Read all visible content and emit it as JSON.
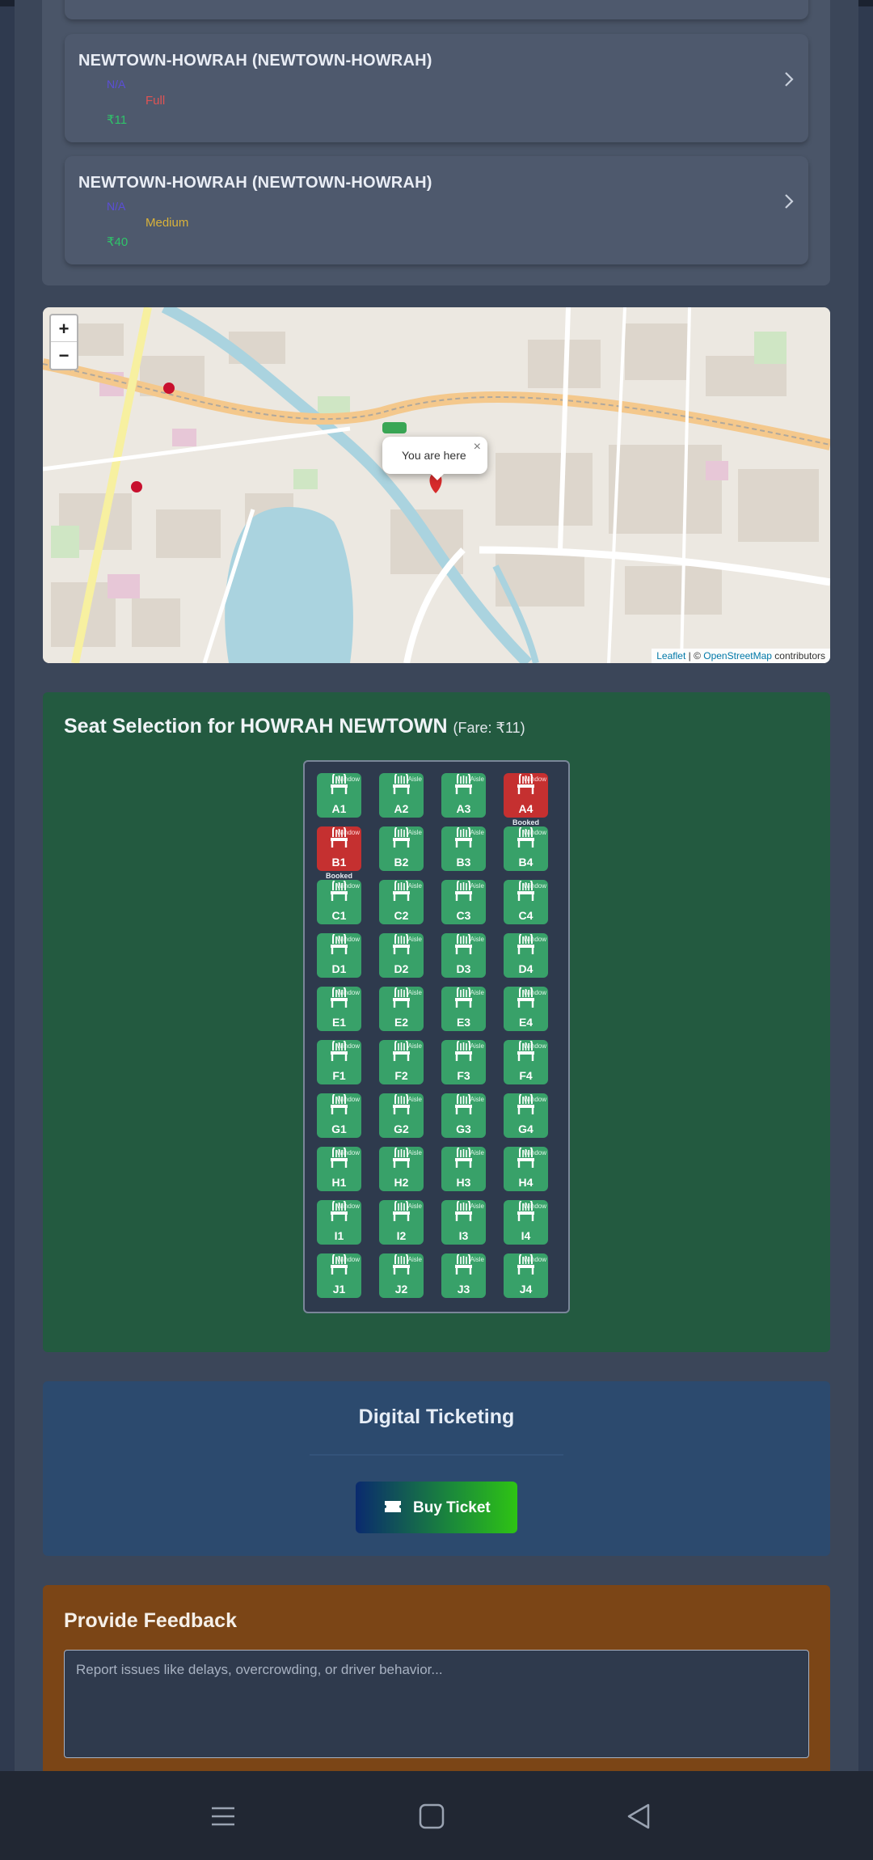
{
  "routes": [
    {
      "title": "NEWTOWN-HOWRAH (NEWTOWN-HOWRAH)",
      "na": "N/A",
      "crowd": "Full",
      "crowd_color": "#e05353",
      "fare": "₹11"
    },
    {
      "title": "NEWTOWN-HOWRAH (NEWTOWN-HOWRAH)",
      "na": "N/A",
      "crowd": "Medium",
      "crowd_color": "#d9b23a",
      "fare": "₹40"
    }
  ],
  "map": {
    "zoom_in": "+",
    "zoom_out": "−",
    "popup_text": "You are here",
    "popup_close": "×",
    "attribution_leaflet": "Leaflet",
    "attribution_sep": " | © ",
    "attribution_osm": "OpenStreetMap",
    "attribution_tail": " contributors"
  },
  "seat_selection": {
    "title": "Seat Selection for HOWRAH NEWTOWN",
    "fare": "(Fare: ₹11)",
    "booked_note": "Booked",
    "rows": [
      {
        "seats": [
          {
            "id": "A1",
            "tag": "Window",
            "booked": false
          },
          {
            "id": "A2",
            "tag": "Aisle",
            "booked": false
          },
          {
            "id": "A3",
            "tag": "Aisle",
            "booked": false
          },
          {
            "id": "A4",
            "tag": "Window",
            "booked": true
          }
        ]
      },
      {
        "seats": [
          {
            "id": "B1",
            "tag": "Window",
            "booked": true
          },
          {
            "id": "B2",
            "tag": "Aisle",
            "booked": false
          },
          {
            "id": "B3",
            "tag": "Aisle",
            "booked": false
          },
          {
            "id": "B4",
            "tag": "Window",
            "booked": false
          }
        ]
      },
      {
        "seats": [
          {
            "id": "C1",
            "tag": "Window",
            "booked": false
          },
          {
            "id": "C2",
            "tag": "Aisle",
            "booked": false
          },
          {
            "id": "C3",
            "tag": "Aisle",
            "booked": false
          },
          {
            "id": "C4",
            "tag": "Window",
            "booked": false
          }
        ]
      },
      {
        "seats": [
          {
            "id": "D1",
            "tag": "Window",
            "booked": false
          },
          {
            "id": "D2",
            "tag": "Aisle",
            "booked": false
          },
          {
            "id": "D3",
            "tag": "Aisle",
            "booked": false
          },
          {
            "id": "D4",
            "tag": "Window",
            "booked": false
          }
        ]
      },
      {
        "seats": [
          {
            "id": "E1",
            "tag": "Window",
            "booked": false
          },
          {
            "id": "E2",
            "tag": "Aisle",
            "booked": false
          },
          {
            "id": "E3",
            "tag": "Aisle",
            "booked": false
          },
          {
            "id": "E4",
            "tag": "Window",
            "booked": false
          }
        ]
      },
      {
        "seats": [
          {
            "id": "F1",
            "tag": "Window",
            "booked": false
          },
          {
            "id": "F2",
            "tag": "Aisle",
            "booked": false
          },
          {
            "id": "F3",
            "tag": "Aisle",
            "booked": false
          },
          {
            "id": "F4",
            "tag": "Window",
            "booked": false
          }
        ]
      },
      {
        "seats": [
          {
            "id": "G1",
            "tag": "Window",
            "booked": false
          },
          {
            "id": "G2",
            "tag": "Aisle",
            "booked": false
          },
          {
            "id": "G3",
            "tag": "Aisle",
            "booked": false
          },
          {
            "id": "G4",
            "tag": "Window",
            "booked": false
          }
        ]
      },
      {
        "seats": [
          {
            "id": "H1",
            "tag": "Window",
            "booked": false
          },
          {
            "id": "H2",
            "tag": "Aisle",
            "booked": false
          },
          {
            "id": "H3",
            "tag": "Aisle",
            "booked": false
          },
          {
            "id": "H4",
            "tag": "Window",
            "booked": false
          }
        ]
      },
      {
        "seats": [
          {
            "id": "I1",
            "tag": "Window",
            "booked": false
          },
          {
            "id": "I2",
            "tag": "Aisle",
            "booked": false
          },
          {
            "id": "I3",
            "tag": "Aisle",
            "booked": false
          },
          {
            "id": "I4",
            "tag": "Window",
            "booked": false
          }
        ]
      },
      {
        "seats": [
          {
            "id": "J1",
            "tag": "Window",
            "booked": false
          },
          {
            "id": "J2",
            "tag": "Aisle",
            "booked": false
          },
          {
            "id": "J3",
            "tag": "Aisle",
            "booked": false
          },
          {
            "id": "J4",
            "tag": "Window",
            "booked": false
          }
        ]
      }
    ]
  },
  "ticketing": {
    "title": "Digital Ticketing",
    "button": "Buy Ticket"
  },
  "feedback": {
    "title": "Provide Feedback",
    "placeholder": "Report issues like delays, overcrowding, or driver behavior..."
  },
  "colors": {
    "seat_available": "#38a169",
    "seat_booked": "#c53030",
    "fare_green": "#2fc46a",
    "na_purple": "#5b4ed6"
  },
  "icons": {
    "route_chevron": "chevron-right-icon",
    "seat": "chair-icon",
    "ticket": "ticket-icon",
    "nav_menu": "menu-icon",
    "nav_home": "square-icon",
    "nav_back": "back-icon"
  }
}
